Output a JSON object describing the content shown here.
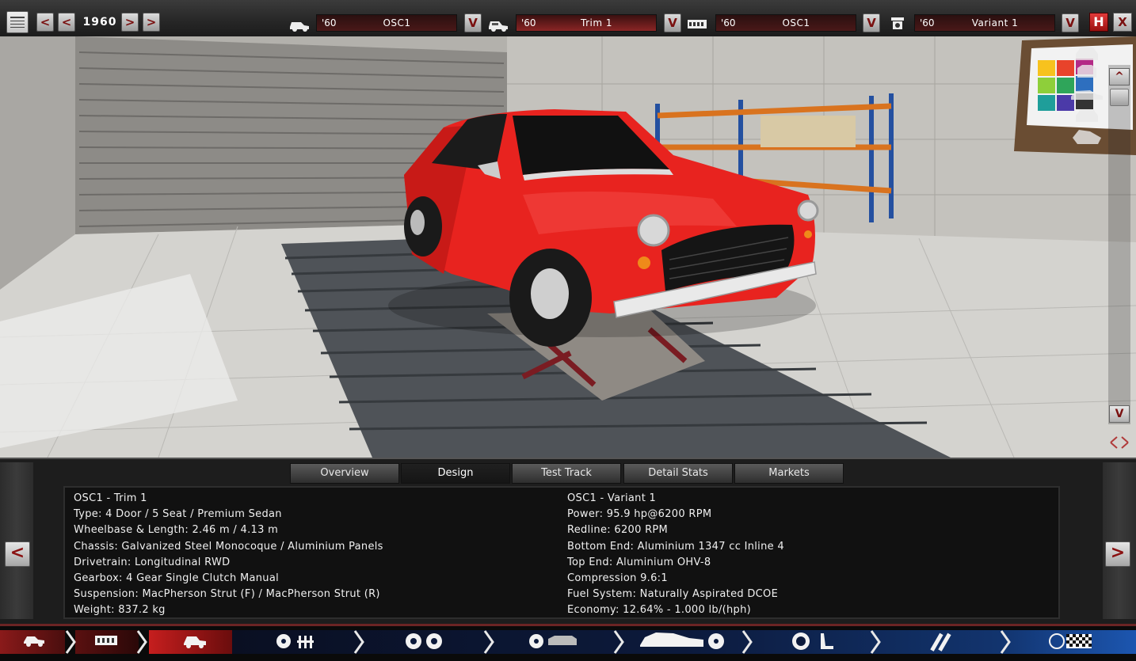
{
  "toolbar": {
    "year": "1960",
    "prev_big": "<",
    "prev_small": "<",
    "next_small": ">",
    "next_big": ">",
    "selectors": [
      {
        "icon": "car-model-icon",
        "year": "'60",
        "name": "OSC1",
        "dropdown": "V"
      },
      {
        "icon": "car-trim-icon",
        "year": "'60",
        "name": "Trim 1",
        "dropdown": "V"
      },
      {
        "icon": "engine-block-icon",
        "year": "'60",
        "name": "OSC1",
        "dropdown": "V"
      },
      {
        "icon": "engine-variant-icon",
        "year": "'60",
        "name": "Variant 1",
        "dropdown": "V"
      }
    ],
    "save_label": "H",
    "close_label": "X"
  },
  "viewport": {
    "scroll_up": "^",
    "scroll_down": "V",
    "camera_icons": [
      "camera-front-icon",
      "camera-top-icon",
      "camera-side-icon",
      "camera-rear-icon",
      "camera-angle-icon"
    ]
  },
  "tabs": [
    "Overview",
    "Design",
    "Test Track",
    "Detail Stats",
    "Markets"
  ],
  "active_tab": "Design",
  "nav": {
    "prev": "<",
    "next": ">"
  },
  "car_info": {
    "trim": [
      "OSC1 - Trim 1",
      "Type: 4 Door / 5 Seat / Premium Sedan",
      "Wheelbase & Length: 2.46 m / 4.13 m",
      "Chassis: Galvanized Steel Monocoque / Aluminium Panels",
      "Drivetrain: Longitudinal RWD",
      "Gearbox: 4 Gear Single Clutch Manual",
      "Suspension: MacPherson Strut (F) / MacPherson Strut (R)",
      "Weight: 837.2 kg"
    ],
    "engine": [
      "OSC1 - Variant 1",
      "Power: 95.9 hp@6200 RPM",
      "Redline: 6200 RPM",
      "Bottom End: Aluminium 1347 cc Inline 4",
      "Top End: Aluminium OHV-8",
      "Compression 9.6:1",
      "Fuel System: Naturally Aspirated DCOE",
      "Economy: 12.64% - 1.000 lb/(hph)"
    ]
  },
  "stages": [
    "car-model-stage-icon",
    "engine-block-stage-icon",
    "trim-stage-icon",
    "engine-parts-stage-icon",
    "wheels-stage-icon",
    "body-styling-stage-icon",
    "interior-stage-icon",
    "suspension-stage-icon",
    "test-finish-stage-icon"
  ],
  "active_stage": 2,
  "colors": {
    "accent": "#8a1a1a",
    "car": "#e8231f",
    "panel": "#111111"
  }
}
